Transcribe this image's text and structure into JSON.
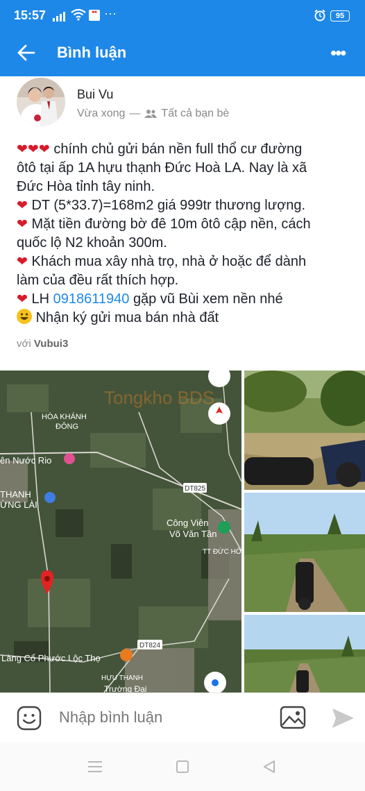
{
  "status_bar": {
    "time": "15:57",
    "battery": "95",
    "more_glyph": "···"
  },
  "header": {
    "title": "Bình luận"
  },
  "post": {
    "author": "Bui Vu",
    "time": "Vừa xong",
    "separator": "—",
    "privacy": "Tất cả bạn bè",
    "lines": [
      "chính chủ gửi bán nền full thổ cư đường",
      "ôtô tại ấp 1A hựu thạnh Đức Hoà LA. Nay là xã",
      "Đức Hòa tỉnh tây ninh.",
      "DT (5*33.7)=168m2 giá 999tr thương lượng.",
      "Mặt tiền đường bờ đê 10m ôtô cập nền, cách",
      "quốc lộ N2 khoản 300m.",
      "Khách mua xây nhà trọ, nhà ở hoặc để dành",
      "làm của đều rất thích hợp.",
      "LH",
      "0918611940",
      "gặp vũ Bùi xem nền nhé",
      "Nhận ký gửi mua bán nhà đất"
    ],
    "tag_prefix": "với",
    "tag_name": "Vubui3"
  },
  "map": {
    "labels": [
      "HÒA KHÁNH",
      "ĐÔNG",
      "ên Nước Rio",
      "THANH",
      "ỪNG LÀI",
      "DT825",
      "Công Viên",
      "Võ Văn Tần",
      "TT ĐỨC HÒ",
      "DT824",
      "Làng Cổ Phước Lộc Thọ",
      "HỰU THANH",
      "Trường Đại"
    ],
    "watermark": "Tongkho BDS"
  },
  "comment_input": {
    "placeholder": "Nhập bình luận"
  },
  "icons": {
    "back": "arrow-left-icon",
    "more": "more-horizontal-icon",
    "friends": "friends-icon",
    "emoji": "emoji-icon",
    "image": "image-icon",
    "send": "send-icon",
    "nav_menu": "menu-icon",
    "nav_home": "home-square-icon",
    "nav_back": "back-triangle-icon"
  },
  "colors": {
    "brand": "#1e88e8",
    "heart": "#d81b2a",
    "link": "#1e88e8"
  }
}
